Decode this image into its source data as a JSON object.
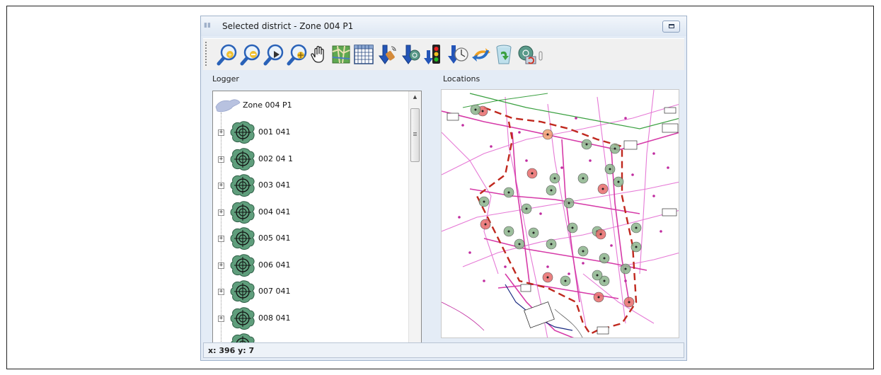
{
  "window": {
    "title": "Selected district - Zone 004 P1"
  },
  "toolbar": {
    "buttons": [
      {
        "name": "zoom-in-icon",
        "label": "Zoom in"
      },
      {
        "name": "zoom-out-icon",
        "label": "Zoom out"
      },
      {
        "name": "zoom-previous-icon",
        "label": "Zoom previous"
      },
      {
        "name": "zoom-extent-icon",
        "label": "Zoom extent"
      },
      {
        "name": "pan-hand-icon",
        "label": "Pan"
      },
      {
        "name": "map-icon",
        "label": "Map"
      },
      {
        "name": "grid-icon",
        "label": "Grid"
      },
      {
        "name": "signal-arrow-icon",
        "label": "Signal"
      },
      {
        "name": "sensor-arrow-icon",
        "label": "Sensor"
      },
      {
        "name": "traffic-light-arrow-icon",
        "label": "Traffic"
      },
      {
        "name": "clock-arrow-icon",
        "label": "Time"
      },
      {
        "name": "sync-arrows-icon",
        "label": "Sync"
      },
      {
        "name": "recycle-bin-icon",
        "label": "Recycle"
      },
      {
        "name": "device-refresh-icon",
        "label": "Refresh"
      }
    ]
  },
  "logger": {
    "label": "Logger",
    "root": "Zone 004 P1",
    "items": [
      "001 041",
      "002 04 1",
      "003 041",
      "004 041",
      "005 041",
      "006 041",
      "007 041",
      "008 041"
    ]
  },
  "locations": {
    "label": "Locations"
  },
  "status": {
    "coords": "x: 396 y: 7"
  },
  "colors": {
    "pipe_main": "#d63aa8",
    "pipe_secondary": "#e67ad6",
    "district_boundary": "#c0281e",
    "node_green": "#8cb48c",
    "node_red": "#e86b6b",
    "node_orange": "#f0a070"
  }
}
